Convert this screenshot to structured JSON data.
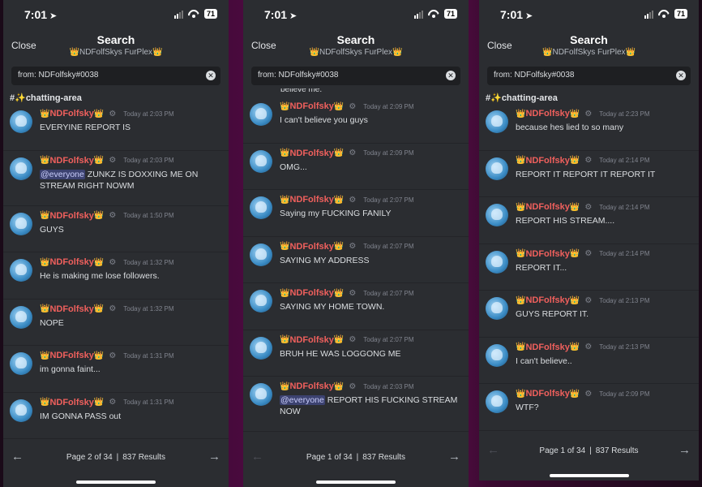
{
  "panels": [
    {
      "time": "7:01",
      "battery": "71",
      "close": "Close",
      "title": "Search",
      "subtitle": "NDFolfSkys FurPlex",
      "search_value": "from: NDFolfsky#0038",
      "channel": "#✨chatting-area",
      "cut_text": "",
      "messages": [
        {
          "user": "NDFolfsky",
          "time": "Today at 2:03 PM",
          "text": "EVERYINE REPORT IS",
          "mention": ""
        },
        {
          "user": "NDFolfsky",
          "time": "Today at 2:03 PM",
          "text": "ZUNKZ IS DOXXING ME ON STREAM RIGHT NOWM",
          "mention": "@everyone"
        },
        {
          "user": "NDFolfsky",
          "time": "Today at 1:50 PM",
          "text": "GUYS",
          "mention": ""
        },
        {
          "user": "NDFolfsky",
          "time": "Today at 1:32 PM",
          "text": "He is making me lose followers.",
          "mention": ""
        },
        {
          "user": "NDFolfsky",
          "time": "Today at 1:32 PM",
          "text": "NOPE",
          "mention": ""
        },
        {
          "user": "NDFolfsky",
          "time": "Today at 1:31 PM",
          "text": "im gonna faint...",
          "mention": ""
        },
        {
          "user": "NDFolfsky",
          "time": "Today at 1:31 PM",
          "text": "IM GONNA PASS out",
          "mention": ""
        }
      ],
      "page": "Page 2 of 34",
      "results": "837 Results"
    },
    {
      "time": "7:01",
      "battery": "71",
      "close": "Close",
      "title": "Search",
      "subtitle": "NDFolfSkys FurPlex",
      "search_value": "from: NDFolfsky#0038",
      "channel": "",
      "cut_text": "believe me.",
      "messages": [
        {
          "user": "NDFolfsky",
          "time": "Today at 2:09 PM",
          "text": "I can't believe you guys",
          "mention": ""
        },
        {
          "user": "NDFolfsky",
          "time": "Today at 2:09 PM",
          "text": "OMG...",
          "mention": ""
        },
        {
          "user": "NDFolfsky",
          "time": "Today at 2:07 PM",
          "text": "Saying my FUCKING FANILY",
          "mention": ""
        },
        {
          "user": "NDFolfsky",
          "time": "Today at 2:07 PM",
          "text": "SAYING MY ADDRESS",
          "mention": ""
        },
        {
          "user": "NDFolfsky",
          "time": "Today at 2:07 PM",
          "text": "SAYING MY HOME TOWN.",
          "mention": ""
        },
        {
          "user": "NDFolfsky",
          "time": "Today at 2:07 PM",
          "text": "BRUH HE WAS LOGGONG ME",
          "mention": ""
        },
        {
          "user": "NDFolfsky",
          "time": "Today at 2:03 PM",
          "text": "REPORT HIS FUCKING STREAM NOW",
          "mention": "@everyone"
        }
      ],
      "page": "Page 1 of 34",
      "results": "837 Results"
    },
    {
      "time": "7:01",
      "battery": "71",
      "close": "Close",
      "title": "Search",
      "subtitle": "NDFolfSkys FurPlex",
      "search_value": "from: NDFolfsky#0038",
      "channel": "#✨chatting-area",
      "cut_text": "",
      "messages": [
        {
          "user": "NDFolfsky",
          "time": "Today at 2:23 PM",
          "text": "because hes lied to so many",
          "mention": ""
        },
        {
          "user": "NDFolfsky",
          "time": "Today at 2:14 PM",
          "text": "REPORT IT REPORT IT REPORT IT",
          "mention": ""
        },
        {
          "user": "NDFolfsky",
          "time": "Today at 2:14 PM",
          "text": "REPORT HIS STREAM....",
          "mention": ""
        },
        {
          "user": "NDFolfsky",
          "time": "Today at 2:14 PM",
          "text": "REPORT IT...",
          "mention": ""
        },
        {
          "user": "NDFolfsky",
          "time": "Today at 2:13 PM",
          "text": "GUYS REPORT IT.",
          "mention": ""
        },
        {
          "user": "NDFolfsky",
          "time": "Today at 2:13 PM",
          "text": "I can't believe..",
          "mention": ""
        },
        {
          "user": "NDFolfsky",
          "time": "Today at 2:09 PM",
          "text": "WTF?",
          "mention": ""
        }
      ],
      "page": "Page 1 of 34",
      "results": "837 Results"
    }
  ],
  "icons": {
    "crown": "👑",
    "gear": "⚙",
    "clear": "✕",
    "arrow_left": "←",
    "arrow_right": "→",
    "location": "➤"
  },
  "colors": {
    "username": "#f0605d",
    "background": "#2b2d31",
    "search_bg": "#1e1f22",
    "mention_bg": "#3c4270"
  }
}
